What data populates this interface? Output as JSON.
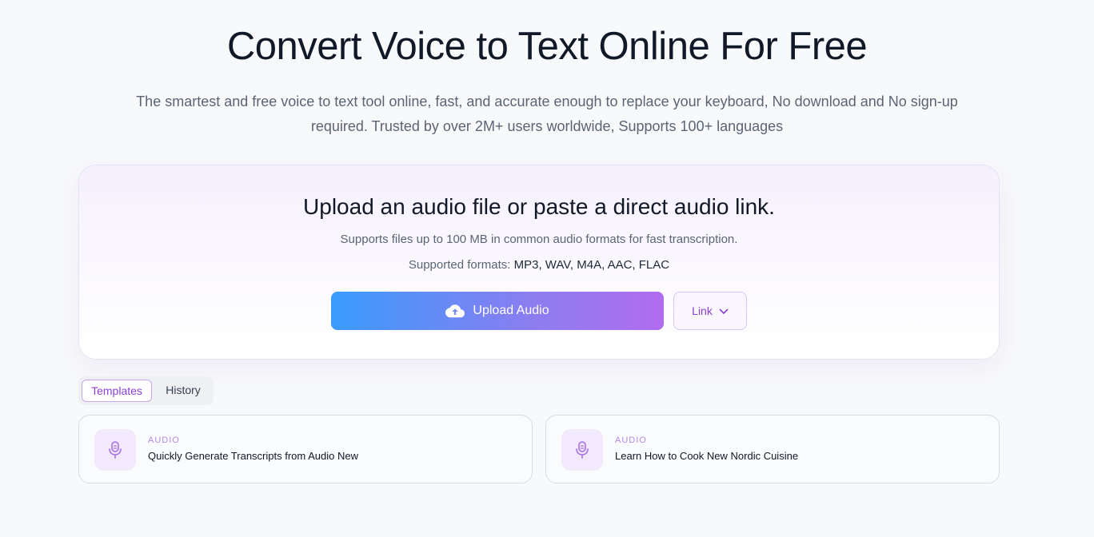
{
  "hero": {
    "title": "Convert Voice to Text Online For Free",
    "subtitle": "The smartest and free voice to text tool online, fast, and accurate enough to replace your keyboard, No download and No sign-up required. Trusted by over 2M+ users worldwide, Supports 100+ languages"
  },
  "upload": {
    "title": "Upload an audio file or paste a direct audio link.",
    "subtitle": "Supports files up to 100 MB in common audio formats for fast transcription.",
    "formats_label": "Supported formats:",
    "formats_value": "MP3, WAV, M4A, AAC, FLAC",
    "button_label": "Upload Audio",
    "button_icon": "cloud-upload-icon",
    "link_label": "Link",
    "link_icon": "chevron-down-icon"
  },
  "tabs": [
    {
      "label": "Templates",
      "active": true
    },
    {
      "label": "History",
      "active": false
    }
  ],
  "templates": [
    {
      "tag": "AUDIO",
      "title": "Quickly Generate Transcripts from Audio New",
      "icon": "microphone-icon"
    },
    {
      "tag": "AUDIO",
      "title": "Learn How to Cook New Nordic Cuisine",
      "icon": "microphone-icon"
    }
  ],
  "colors": {
    "accent": "#8a3fd1",
    "gradient_start": "#3a9bfd",
    "gradient_end": "#b16cf0"
  }
}
